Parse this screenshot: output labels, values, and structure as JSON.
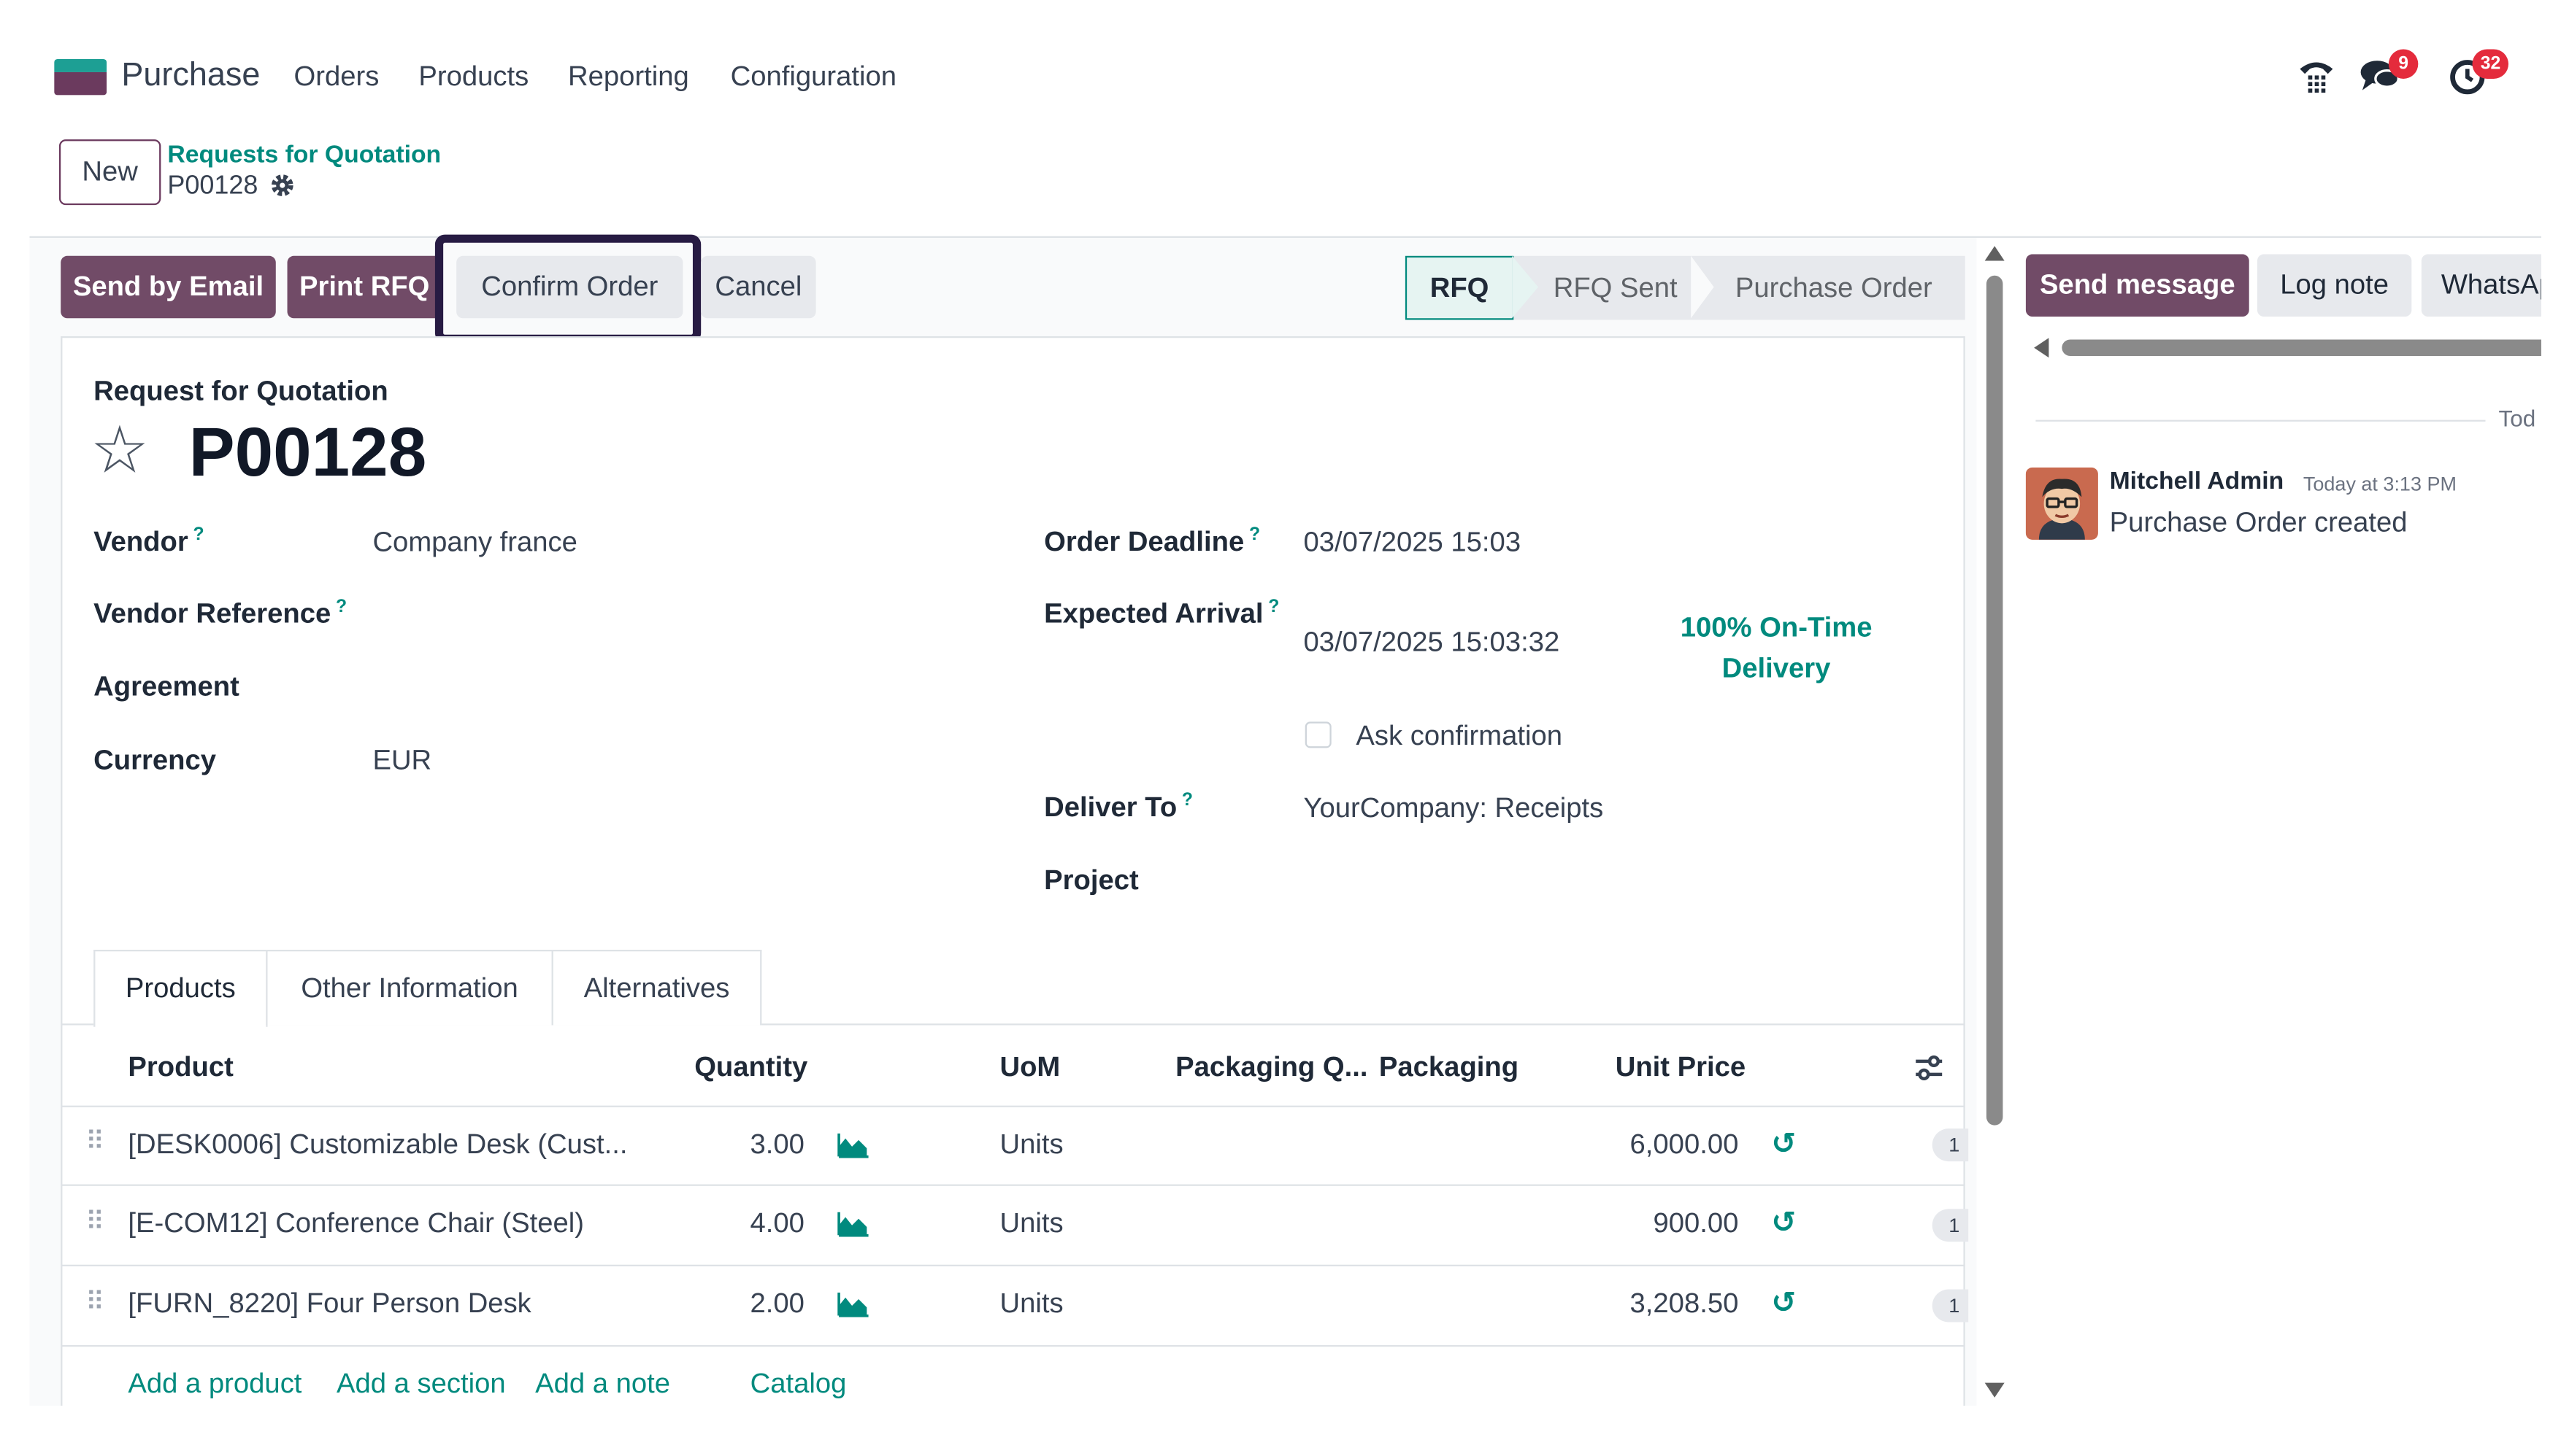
{
  "nav": {
    "app_name": "Purchase",
    "menu": [
      "Orders",
      "Products",
      "Reporting",
      "Configuration"
    ],
    "messages_badge": "9",
    "activities_badge": "32",
    "icons": [
      "phone-icon",
      "messages-icon",
      "activity-clock-icon"
    ]
  },
  "breadcrumb": {
    "new_label": "New",
    "parent": "Requests for Quotation",
    "current": "P00128"
  },
  "actions": {
    "send_email": "Send by Email",
    "print_rfq": "Print RFQ",
    "confirm": "Confirm Order",
    "cancel": "Cancel"
  },
  "status": {
    "steps": [
      "RFQ",
      "RFQ Sent",
      "Purchase Order"
    ],
    "active": "RFQ"
  },
  "form": {
    "title_small": "Request for Quotation",
    "title": "P00128",
    "vendor_label": "Vendor",
    "vendor": "Company france",
    "vendor_ref_label": "Vendor Reference",
    "agreement_label": "Agreement",
    "currency_label": "Currency",
    "currency": "EUR",
    "deadline_label": "Order Deadline",
    "deadline": "03/07/2025 15:03",
    "arrival_label": "Expected Arrival",
    "arrival": "03/07/2025 15:03:32",
    "ontime": "100% On-Time Delivery",
    "ask_confirmation": "Ask confirmation",
    "deliver_label": "Deliver To",
    "deliver": "YourCompany: Receipts",
    "project_label": "Project",
    "help_mark": "?"
  },
  "tabs": [
    "Products",
    "Other Information",
    "Alternatives"
  ],
  "table": {
    "columns": [
      "Product",
      "Quantity",
      "UoM",
      "Packaging Q...",
      "Packaging",
      "Unit Price"
    ],
    "rows": [
      {
        "product": "[DESK0006] Customizable Desk (Cust...",
        "qty": "3.00",
        "uom": "Units",
        "price": "6,000.00",
        "pill": "1"
      },
      {
        "product": "[E-COM12] Conference Chair (Steel)",
        "qty": "4.00",
        "uom": "Units",
        "price": "900.00",
        "pill": "1"
      },
      {
        "product": "[FURN_8220] Four Person Desk",
        "qty": "2.00",
        "uom": "Units",
        "price": "3,208.50",
        "pill": "1"
      }
    ],
    "add_links": [
      "Add a product",
      "Add a section",
      "Add a note",
      "Catalog"
    ]
  },
  "chatter": {
    "send_message": "Send message",
    "log_note": "Log note",
    "whatsapp": "WhatsAp",
    "today": "Tod",
    "author": "Mitchell Admin",
    "time": "Today at 3:13 PM",
    "body": "Purchase Order created"
  },
  "colors": {
    "primary": "#714b67",
    "accent": "#018a7e",
    "highlight_border": "#271b43",
    "badge": "#e42b3c"
  }
}
